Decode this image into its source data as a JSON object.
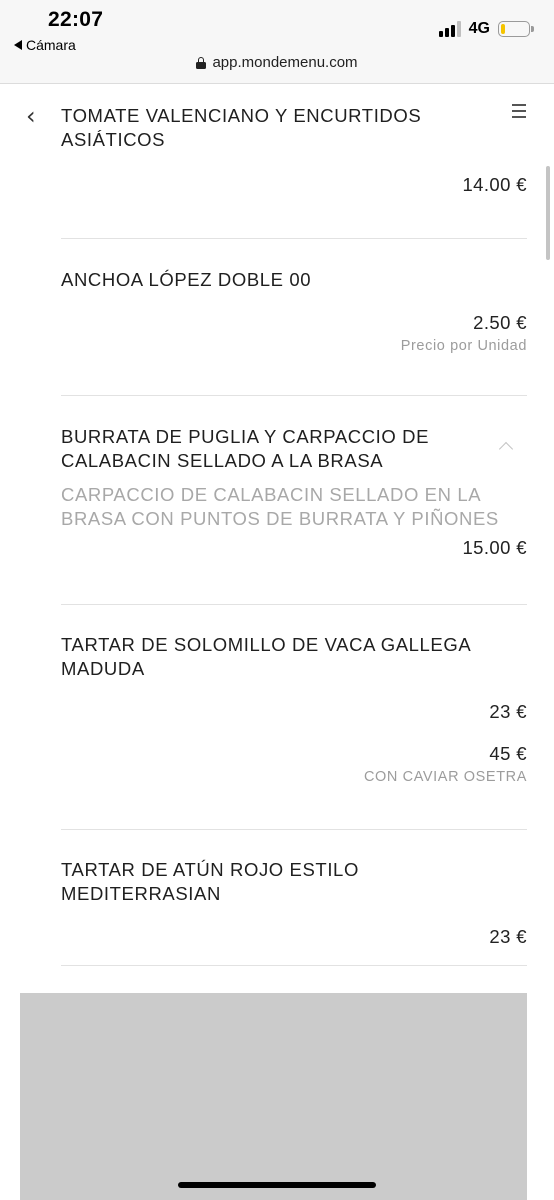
{
  "status_bar": {
    "time": "22:07",
    "back_app": "Cámara",
    "network": "4G",
    "signal_bars_filled": 3,
    "signal_bars_total": 4,
    "battery_level": 0.15,
    "battery_color": "#f5c400"
  },
  "browser": {
    "url": "app.mondemenu.com"
  },
  "nav": {
    "back_icon": "chevron-left-icon",
    "menu_icon": "hamburger-menu-icon"
  },
  "items": [
    {
      "title": "TOMATE VALENCIANO Y ENCURTIDOS ASIÁTICOS",
      "prices": [
        {
          "price": "14.00 €"
        }
      ]
    },
    {
      "title": "ANCHOA LÓPEZ DOBLE 00",
      "prices": [
        {
          "price": "2.50 €",
          "note": "Precio por Unidad"
        }
      ]
    },
    {
      "title": "BURRATA DE PUGLIA Y CARPACCIO DE CALABACIN SELLADO A LA BRASA",
      "description": "CARPACCIO DE CALABACIN SELLADO EN LA BRASA CON PUNTOS DE BURRATA Y PIÑONES",
      "expanded": true,
      "prices": [
        {
          "price": "15.00 €"
        }
      ]
    },
    {
      "title": "TARTAR DE SOLOMILLO DE VACA GALLEGA MADUDA",
      "prices": [
        {
          "price": "23 €"
        },
        {
          "price": "45 €",
          "note": "CON CAVIAR OSETRA"
        }
      ]
    },
    {
      "title": "TARTAR DE ATÚN ROJO ESTILO MEDITERRASIAN",
      "prices": [
        {
          "price": "23 €"
        }
      ]
    }
  ]
}
